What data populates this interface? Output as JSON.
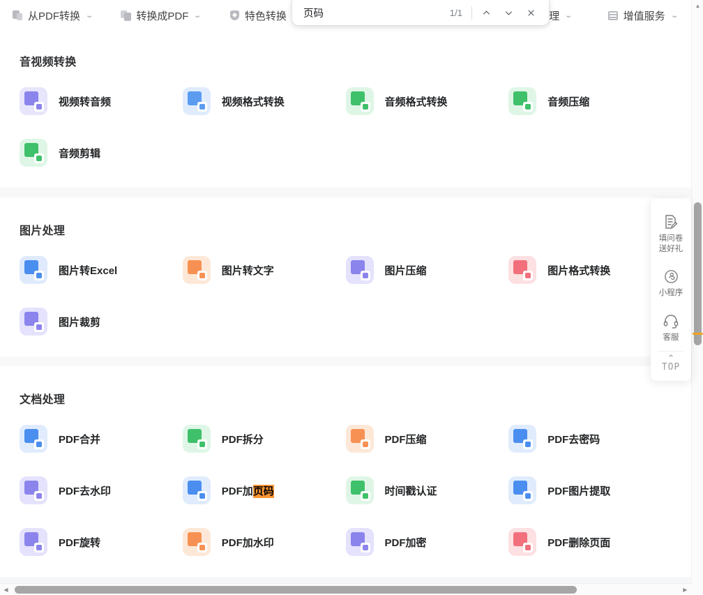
{
  "nav": {
    "items": [
      {
        "label": "从PDF转换",
        "icon": "doc-stack-icon",
        "chevron": "⌄"
      },
      {
        "label": "转换成PDF",
        "icon": "doc-stack-alt-icon",
        "chevron": "⌄"
      },
      {
        "label": "特色转换",
        "icon": "shield-icon",
        "chevron": "⌄"
      },
      {
        "label": "处理",
        "icon": "hidden-icon",
        "chevron": "⌄"
      },
      {
        "label": "增值服务",
        "icon": "lines-icon",
        "chevron": "⌄"
      }
    ]
  },
  "findbar": {
    "query": "页码",
    "placeholder": "",
    "counter": "1/1",
    "prev_label": "上一个",
    "next_label": "下一个",
    "close_label": "关闭"
  },
  "sections": [
    {
      "title": "音视频转换",
      "tools": [
        {
          "label": "视频转音频",
          "tile_bg": "#e7e5fb",
          "main": "#8b84ec",
          "badge": "#8b84ec"
        },
        {
          "label": "视频格式转换",
          "tile_bg": "#e0ecfd",
          "main": "#5b9cf0",
          "badge": "#5b9cf0"
        },
        {
          "label": "音频格式转换",
          "tile_bg": "#dff6e7",
          "main": "#3fc06a",
          "badge": "#3fc06a"
        },
        {
          "label": "音频压缩",
          "tile_bg": "#dff6e7",
          "main": "#3fc06a",
          "badge": "#3fc06a"
        },
        {
          "label": "音频剪辑",
          "tile_bg": "#dff6e7",
          "main": "#3fc06a",
          "badge": "#3fc06a"
        }
      ]
    },
    {
      "title": "图片处理",
      "tools": [
        {
          "label": "图片转Excel",
          "tile_bg": "#dfeafd",
          "main": "#4a8ef0",
          "badge": "#4a8ef0"
        },
        {
          "label": "图片转文字",
          "tile_bg": "#fde8d8",
          "main": "#f79153",
          "badge": "#f79153"
        },
        {
          "label": "图片压缩",
          "tile_bg": "#e4e2fc",
          "main": "#8b84ec",
          "badge": "#8b84ec"
        },
        {
          "label": "图片格式转换",
          "tile_bg": "#fde0e2",
          "main": "#f2707c",
          "badge": "#f2707c"
        },
        {
          "label": "图片裁剪",
          "tile_bg": "#e4e2fc",
          "main": "#8b84ec",
          "badge": "#8b84ec"
        }
      ]
    },
    {
      "title": "文档处理",
      "tools": [
        {
          "label": "PDF合并",
          "tile_bg": "#e0ecfd",
          "main": "#4a8ef0",
          "badge": "#4a8ef0"
        },
        {
          "label": "PDF拆分",
          "tile_bg": "#dff6e7",
          "main": "#3fc06a",
          "badge": "#3fc06a"
        },
        {
          "label": "PDF压缩",
          "tile_bg": "#fde8d8",
          "main": "#f79153",
          "badge": "#f79153"
        },
        {
          "label": "PDF去密码",
          "tile_bg": "#e0ecfd",
          "main": "#4a8ef0",
          "badge": "#4a8ef0"
        },
        {
          "label": "PDF去水印",
          "tile_bg": "#e4e2fc",
          "main": "#8b84ec",
          "badge": "#8b84ec"
        },
        {
          "label": "PDF加页码",
          "label_prefix": "PDF加",
          "label_highlight": "页码",
          "tile_bg": "#e0ecfd",
          "main": "#4a8ef0",
          "badge": "#4a8ef0"
        },
        {
          "label": "时间戳认证",
          "tile_bg": "#dff6e7",
          "main": "#3fc06a",
          "badge": "#3fc06a"
        },
        {
          "label": "PDF图片提取",
          "tile_bg": "#e0ecfd",
          "main": "#4a8ef0",
          "badge": "#4a8ef0"
        },
        {
          "label": "PDF旋转",
          "tile_bg": "#e4e2fc",
          "main": "#8b84ec",
          "badge": "#8b84ec"
        },
        {
          "label": "PDF加水印",
          "tile_bg": "#fde8d8",
          "main": "#f79153",
          "badge": "#f79153"
        },
        {
          "label": "PDF加密",
          "tile_bg": "#e4e2fc",
          "main": "#8b84ec",
          "badge": "#8b84ec"
        },
        {
          "label": "PDF删除页面",
          "tile_bg": "#fde0e2",
          "main": "#f2707c",
          "badge": "#f2707c"
        }
      ]
    }
  ],
  "side_widget": {
    "items": [
      {
        "icon": "survey-icon",
        "text": "填问卷\n送好礼"
      },
      {
        "icon": "miniapp-icon",
        "text": "小程序"
      },
      {
        "icon": "headset-icon",
        "text": "客服"
      }
    ],
    "top": {
      "caret": "⌃",
      "label": "TOP"
    }
  },
  "scroll": {
    "v_up": "▲",
    "v_down": "▼",
    "h_left": "◀",
    "h_right": "▶"
  },
  "colors": {
    "find_highlight": "#ff9632",
    "scroll_tick": "#f6a623",
    "page_bg": "#f6f7f8"
  }
}
